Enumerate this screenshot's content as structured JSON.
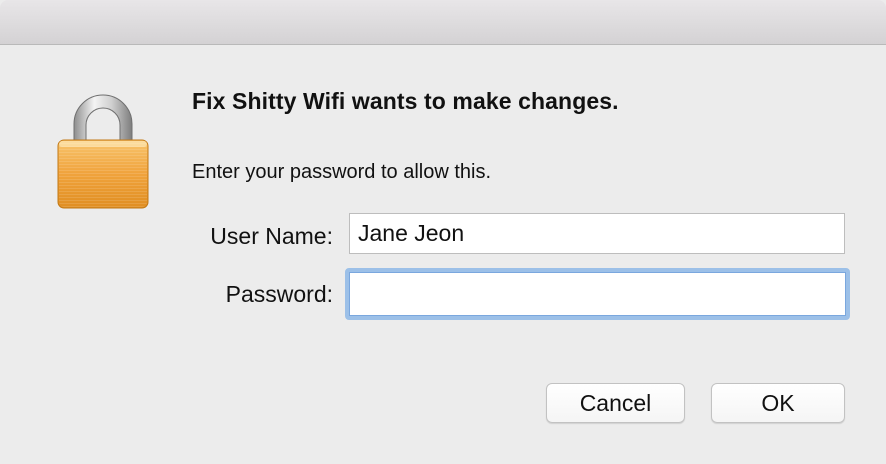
{
  "dialog": {
    "icon": "lock-icon",
    "headline": "Fix Shitty Wifi wants to make changes.",
    "subtext": "Enter your password to allow this."
  },
  "form": {
    "username_label": "User Name:",
    "username_value": "Jane Jeon",
    "password_label": "Password:",
    "password_value": ""
  },
  "buttons": {
    "cancel_label": "Cancel",
    "ok_label": "OK"
  },
  "colors": {
    "background": "#ececec",
    "focus_ring": "#9cc0e8",
    "lock_body": "#f3a33a"
  }
}
